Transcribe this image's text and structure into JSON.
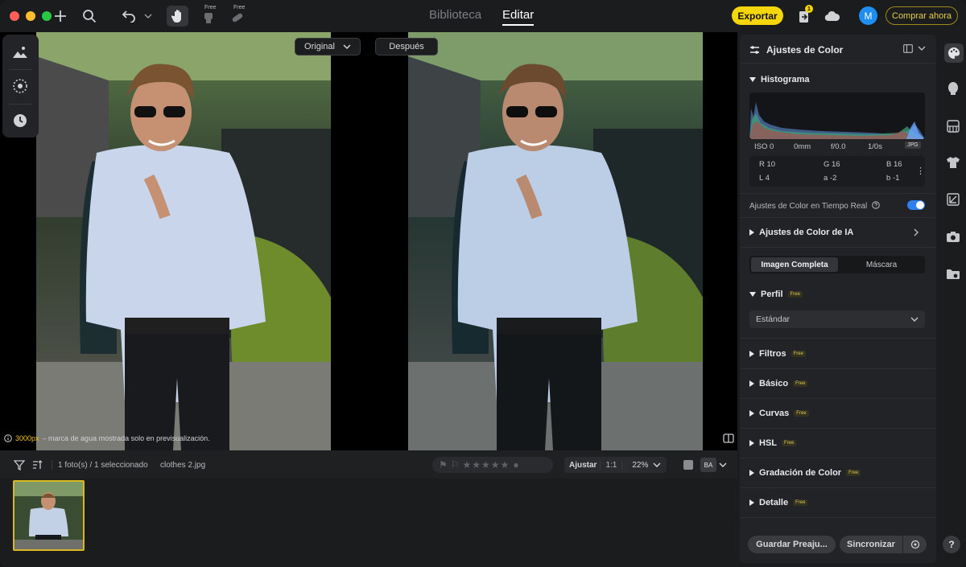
{
  "topbar": {
    "tab_library": "Biblioteca",
    "tab_edit": "Editar",
    "free_badge_1": "Free",
    "free_badge_2": "Free",
    "export_label": "Exportar",
    "notification_count": "1",
    "avatar_initial": "M",
    "buy_label": "Comprar ahora"
  },
  "viewer": {
    "original_label": "Original",
    "after_label": "Después",
    "watermark_px": "3000px",
    "watermark_text": "– marca de agua mostrada solo en previsualización."
  },
  "filmstrip": {
    "count_label": "1 foto(s) / 1 seleccionado",
    "file_name": "clothes 2.jpg",
    "rating_stars": 0,
    "fit_label": "Ajustar",
    "one_to_one": "1:1",
    "zoom_label": "22%",
    "ba_label": "BA"
  },
  "panel": {
    "title": "Ajustes de Color",
    "histogram_title": "Histograma",
    "exif": {
      "iso": "ISO 0",
      "focal": "0mm",
      "aperture": "f/0.0",
      "shutter": "1/0s",
      "format": "JPG"
    },
    "rgb": {
      "r": "R 10",
      "g": "G 16",
      "b": "B 16",
      "l": "L 4",
      "a": "a -2",
      "bb": "b -1"
    },
    "realtime_label": "Ajustes de Color en Tiempo Real",
    "realtime_on": true,
    "ai_section": "Ajustes de Color de IA",
    "seg_full": "Imagen Completa",
    "seg_mask": "Máscara",
    "profile_title": "Perfil",
    "profile_value": "Estándar",
    "free_tag": "Free",
    "sections": [
      "Filtros",
      "Básico",
      "Curvas",
      "HSL",
      "Gradación de Color",
      "Detalle"
    ],
    "save_preset": "Guardar Preaju...",
    "sync": "Sincronizar"
  },
  "help_label": "?",
  "colors": {
    "accent_yellow": "#f5d60a",
    "toggle_blue": "#2f80ed",
    "avatar_blue": "#1e8ff0"
  }
}
